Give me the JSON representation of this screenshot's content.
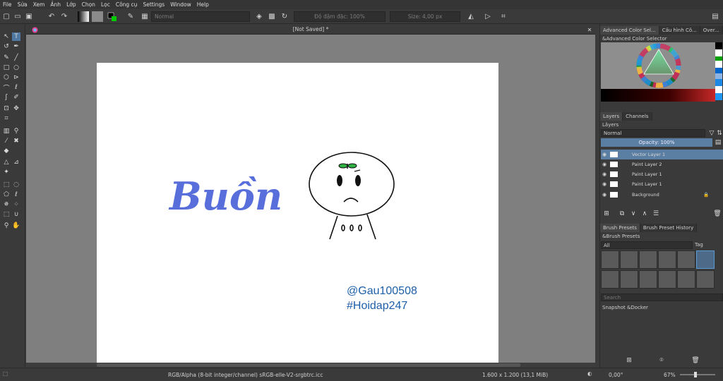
{
  "menu": [
    "File",
    "Sửa",
    "Xem",
    "Ảnh",
    "Lớp",
    "Chọn",
    "Lọc",
    "Công cụ",
    "Settings",
    "Window",
    "Help"
  ],
  "toolbar": {
    "blend_mode": "Normal",
    "opacity_label": "Độ đậm đặc: 100%",
    "size_label": "Size: 4,00 px"
  },
  "document": {
    "title": "[Not Saved]  *"
  },
  "canvas": {
    "text_word": "Buồn",
    "handle": "@Gau100508",
    "hashtag": "#Hoidap247",
    "word_color": "#4a63d8",
    "caption_color": "#1c5fa8"
  },
  "docker_tabs": [
    "Advanced Color Sel...",
    "Cấu hình Cô...",
    "Over..."
  ],
  "color_selector": {
    "title": "&Advanced Color Selector",
    "swatches": [
      "#000000",
      "#ffffff",
      "#00a000",
      "#ffffff",
      "#0066cc",
      "#8db4e2",
      "#1e88e5",
      "#ffffff",
      "#2196f3",
      "#9e9e9e"
    ]
  },
  "layers_tabs": [
    "Layers",
    "Channels"
  ],
  "layers": {
    "title": "Lâyers",
    "blend": "Normal",
    "opacity": "Opacity: 100%",
    "items": [
      {
        "name": "Vector Layer 1",
        "selected": true
      },
      {
        "name": "Paint Layer 2",
        "selected": false
      },
      {
        "name": "Paint Layer 1",
        "selected": false
      },
      {
        "name": "Paint Layer 1",
        "selected": false
      },
      {
        "name": "Background",
        "selected": false
      }
    ]
  },
  "brush_tabs": [
    "Brush Presets",
    "Brush Preset History"
  ],
  "brushes": {
    "title": "&Brush Presets",
    "filter": "All",
    "tag": "Tag",
    "search": "Search"
  },
  "snapshot": {
    "title": "Snapshot &Docker"
  },
  "status": {
    "color_space": "RGB/Alpha (8-bit integer/channel)  sRGB-elle-V2-srgbtrc.icc",
    "dimensions": "1.600 x 1.200 (13,1 MiB)",
    "rotation": "0,00°",
    "zoom": "67%"
  }
}
